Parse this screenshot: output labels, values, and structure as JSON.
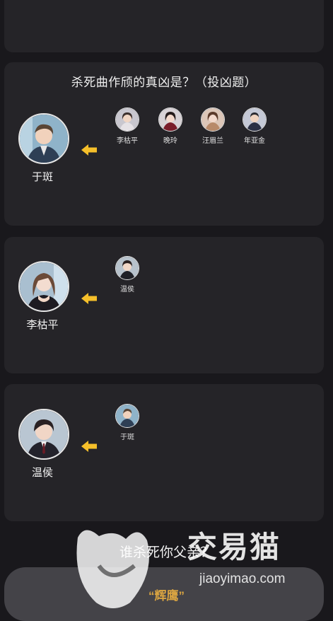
{
  "card1": {
    "title": "杀死曲作颀的真凶是？（投凶题）",
    "main_name": "于斑",
    "votes": [
      "李枯平",
      "晚玲",
      "汪眉兰",
      "年亚金"
    ]
  },
  "card2": {
    "main_name": "李枯平",
    "votes": [
      "温侯"
    ]
  },
  "card3": {
    "main_name": "温侯",
    "votes": [
      "于斑"
    ]
  },
  "bottom": {
    "question": "谁杀死你父亲？",
    "answer": "“辉鹰”"
  },
  "watermark": {
    "text": "交易猫",
    "url": "jiaoyimao.com"
  },
  "colors": {
    "background": "#19181c",
    "card": "#252428",
    "arrow": "#f5bf2a",
    "answer": "#d9a441"
  }
}
